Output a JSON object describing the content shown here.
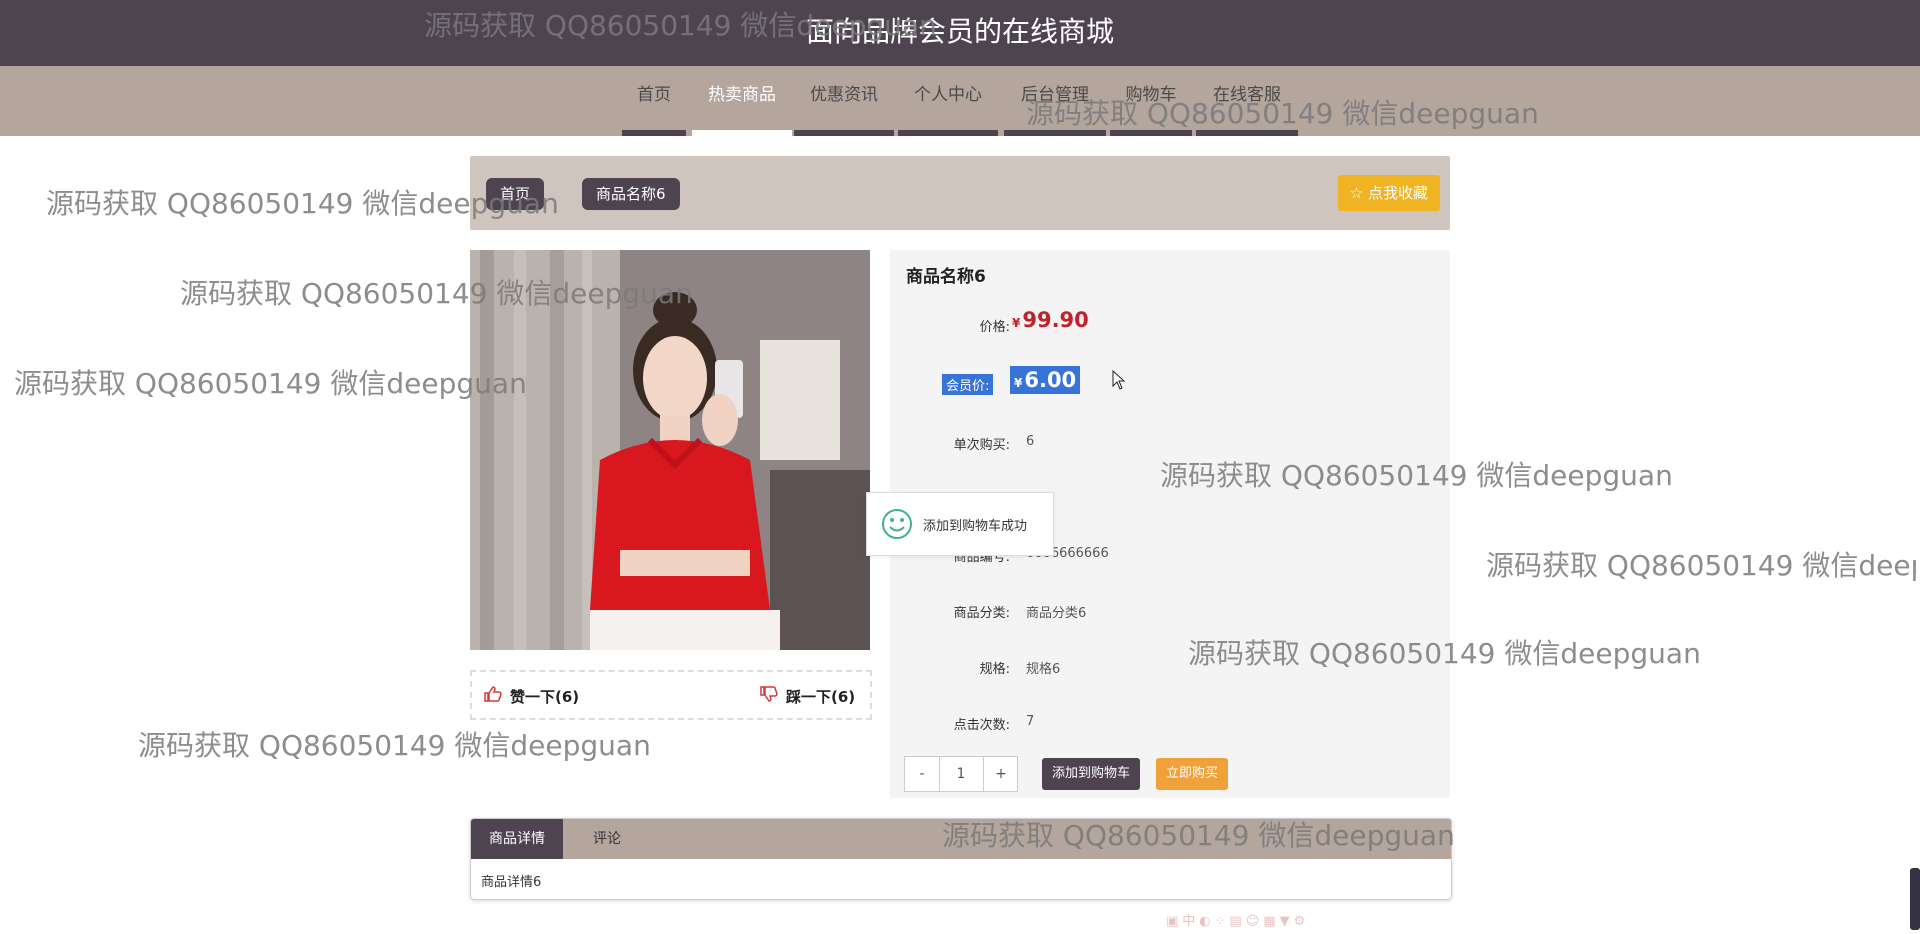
{
  "site": {
    "title": "面向品牌会员的在线商城"
  },
  "nav": {
    "items": [
      {
        "label": "首页"
      },
      {
        "label": "热卖商品"
      },
      {
        "label": "优惠资讯"
      },
      {
        "label": "个人中心"
      },
      {
        "label": "后台管理"
      },
      {
        "label": "购物车"
      },
      {
        "label": "在线客服"
      }
    ],
    "active": "热卖商品"
  },
  "breadcrumb": {
    "home": "首页",
    "current": "商品名称6"
  },
  "favorite": {
    "label": "☆ 点我收藏"
  },
  "product": {
    "name": "商品名称6",
    "price_label": "价格:",
    "currency": "¥",
    "price": "99.90",
    "vip_label": "会员价:",
    "vip_price": "6.00",
    "limit_label": "单次购买:",
    "limit": "6",
    "code_label": "商品编号:",
    "code": "6666666666",
    "category_label": "商品分类:",
    "category": "商品分类6",
    "spec_label": "规格:",
    "spec": "规格6",
    "clicks_label": "点击次数:",
    "clicks": "7"
  },
  "votes": {
    "like": "赞一下(6)",
    "dislike": "踩一下(6)"
  },
  "quantity": {
    "minus": "-",
    "value": "1",
    "plus": "+"
  },
  "actions": {
    "add_to_cart": "添加到购物车",
    "buy_now": "立即购买"
  },
  "toast": {
    "message": "添加到购物车成功"
  },
  "tabs": {
    "detail": "商品详情",
    "comments": "评论",
    "content": "商品详情6"
  },
  "watermark": "源码获取 QQ86050149 微信deepguan",
  "colors": {
    "header": "#4d4450",
    "nav": "#b4a59d",
    "price": "#c2202a",
    "accent": "#f0b323",
    "selection": "#3874d8"
  }
}
